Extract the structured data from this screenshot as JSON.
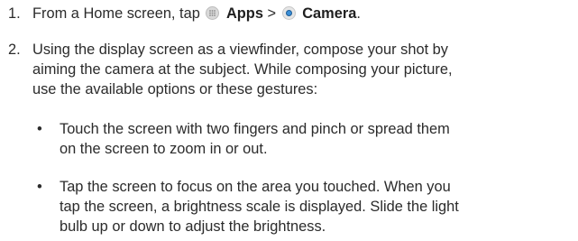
{
  "steps": [
    {
      "number": "1.",
      "pre": "From a Home screen, tap",
      "apps_label": "Apps",
      "separator": ">",
      "camera_label": "Camera",
      "end": "."
    },
    {
      "number": "2.",
      "line1": "Using the display screen as a viewfinder, compose your shot by",
      "line2": "aiming the camera at the subject. While composing your picture,",
      "line3": "use the available options or these gestures:"
    }
  ],
  "bullets": [
    {
      "symbol": "•",
      "line1": "Touch the screen with two fingers and pinch or spread them",
      "line2": "on the screen to zoom in or out."
    },
    {
      "symbol": "•",
      "line1": "Tap the screen to focus on the area you touched. When you",
      "line2": "tap the screen, a brightness scale is displayed. Slide the light",
      "line3": "bulb up or down to adjust the brightness."
    }
  ],
  "icons": {
    "apps": "apps-grid-icon",
    "camera": "camera-icon"
  }
}
